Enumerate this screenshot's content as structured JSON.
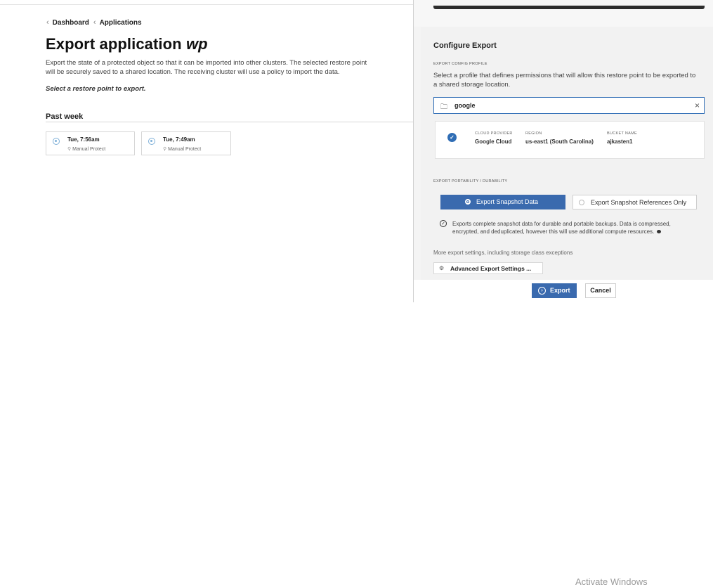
{
  "breadcrumb": {
    "items": [
      "Dashboard",
      "Applications"
    ],
    "chevron": "‹"
  },
  "page": {
    "title_prefix": "Export application",
    "title_app": "wp",
    "description": "Export the state of a protected object so that it can be imported into other clusters. The selected restore point will be securely saved to a shared location. The receiving cluster will use a policy to import the data.",
    "instruction": "Select a restore point to export.",
    "section_title": "Past week"
  },
  "restore_points": [
    {
      "time": "Tue, 7:56am",
      "label": "Manual Protect"
    },
    {
      "time": "Tue, 7:49am",
      "label": "Manual Protect"
    }
  ],
  "configure": {
    "title": "Configure Export",
    "profile_label": "EXPORT CONFIG PROFILE",
    "profile_help": "Select a profile that defines permissions that will allow this restore point to be exported to a shared storage location.",
    "selected_profile": "google",
    "clear_icon": "×",
    "profile_details": {
      "cloud_provider_label": "CLOUD PROVIDER",
      "cloud_provider": "Google Cloud",
      "region_label": "REGION",
      "region": "us-east1 (South Carolina)",
      "bucket_label": "BUCKET NAME",
      "bucket": "ajkasten1"
    },
    "portability_label": "EXPORT PORTABILITY / DURABILITY",
    "options": [
      "Export Snapshot Data",
      "Export Snapshot References Only"
    ],
    "selected_option": "Export Snapshot Data",
    "option_info": "Exports complete snapshot data for durable and portable backups. Data is compressed, encrypted, and deduplicated, however this will use additional compute resources.",
    "more_settings": "More export settings, including storage class exceptions",
    "advanced_button": "Advanced Export Settings ..."
  },
  "footer": {
    "export_label": "Export",
    "cancel_label": "Cancel"
  },
  "watermark": "Activate Windows",
  "colors": {
    "accent": "#3a6aae",
    "select_border": "#2f6db5"
  }
}
